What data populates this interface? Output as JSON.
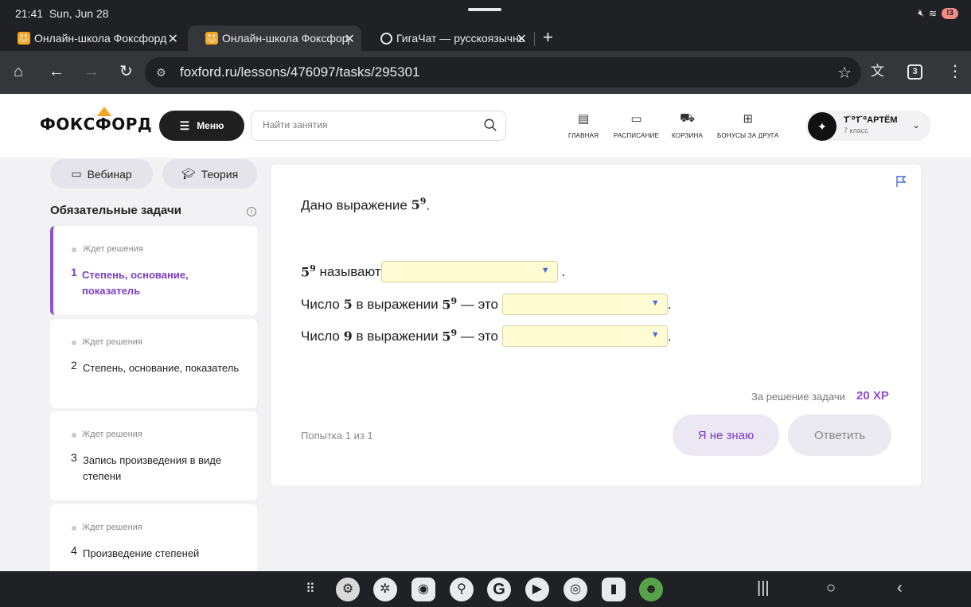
{
  "status": {
    "time": "21:41",
    "date": "Sun, Jun 28",
    "battery": "!3"
  },
  "tabs": [
    {
      "label": "Онлайн-школа Фоксфорд",
      "close": "✕"
    },
    {
      "label": "Онлайн-школа Фоксфорд",
      "close": "✕"
    },
    {
      "label": "ГигаЧат — русскоязычный",
      "close": "✕"
    }
  ],
  "new_tab": "+",
  "toolbar": {
    "url": "foxford.ru/lessons/476097/tasks/295301",
    "tab_count": "3"
  },
  "site": {
    "logo": "ФОКСФОРД",
    "menu_label": "Меню",
    "search_placeholder": "Найти занятия",
    "nav": [
      {
        "label": "ГЛАВНАЯ",
        "icon": "clipboard-icon"
      },
      {
        "label": "РАСПИСАНИЕ",
        "icon": "calendar-icon"
      },
      {
        "label": "КОРЗИНА",
        "icon": "cart-icon"
      },
      {
        "label": "БОНУСЫ ЗА ДРУГА",
        "icon": "gift-icon"
      }
    ],
    "profile": {
      "name": "Т̈ ⁰Т̈ ⁰АРТЁМ",
      "grade": "7 класс"
    }
  },
  "sidebar": {
    "webinar": "Вебинар",
    "theory": "Теория",
    "section_title": "Обязательные задачи",
    "tasks": [
      {
        "status": "Ждет решения",
        "num": "1",
        "title": "Степень, основание, показатель"
      },
      {
        "status": "Ждет решения",
        "num": "2",
        "title": "Степень, основание, показатель"
      },
      {
        "status": "Ждет решения",
        "num": "3",
        "title": "Запись произведения в виде степени"
      },
      {
        "status": "Ждет решения",
        "num": "4",
        "title": "Произведение степеней"
      }
    ]
  },
  "task": {
    "intro": "Дано выражение",
    "base": "5",
    "exp": "9",
    "dot": ".",
    "row1_text": "называют",
    "row2_prefix": "Число",
    "row2_num": "5",
    "row2_mid": "в выражении",
    "row2_suffix": "— это",
    "row3_num": "9",
    "xp_label": "За решение задачи",
    "xp_value": "20 XP",
    "attempt": "Попытка 1 из 1",
    "dunno": "Я не знаю",
    "answer": "Ответить"
  }
}
